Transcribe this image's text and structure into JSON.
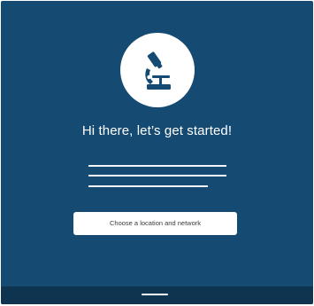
{
  "theme": {
    "background": "#154b72",
    "bottom_bar": "#0f344f",
    "foreground": "#ffffff"
  },
  "logo": {
    "icon": "microscope-icon"
  },
  "onboarding": {
    "headline": "Hi there, let’s get started!",
    "cta_label": "Choose a location and network"
  }
}
